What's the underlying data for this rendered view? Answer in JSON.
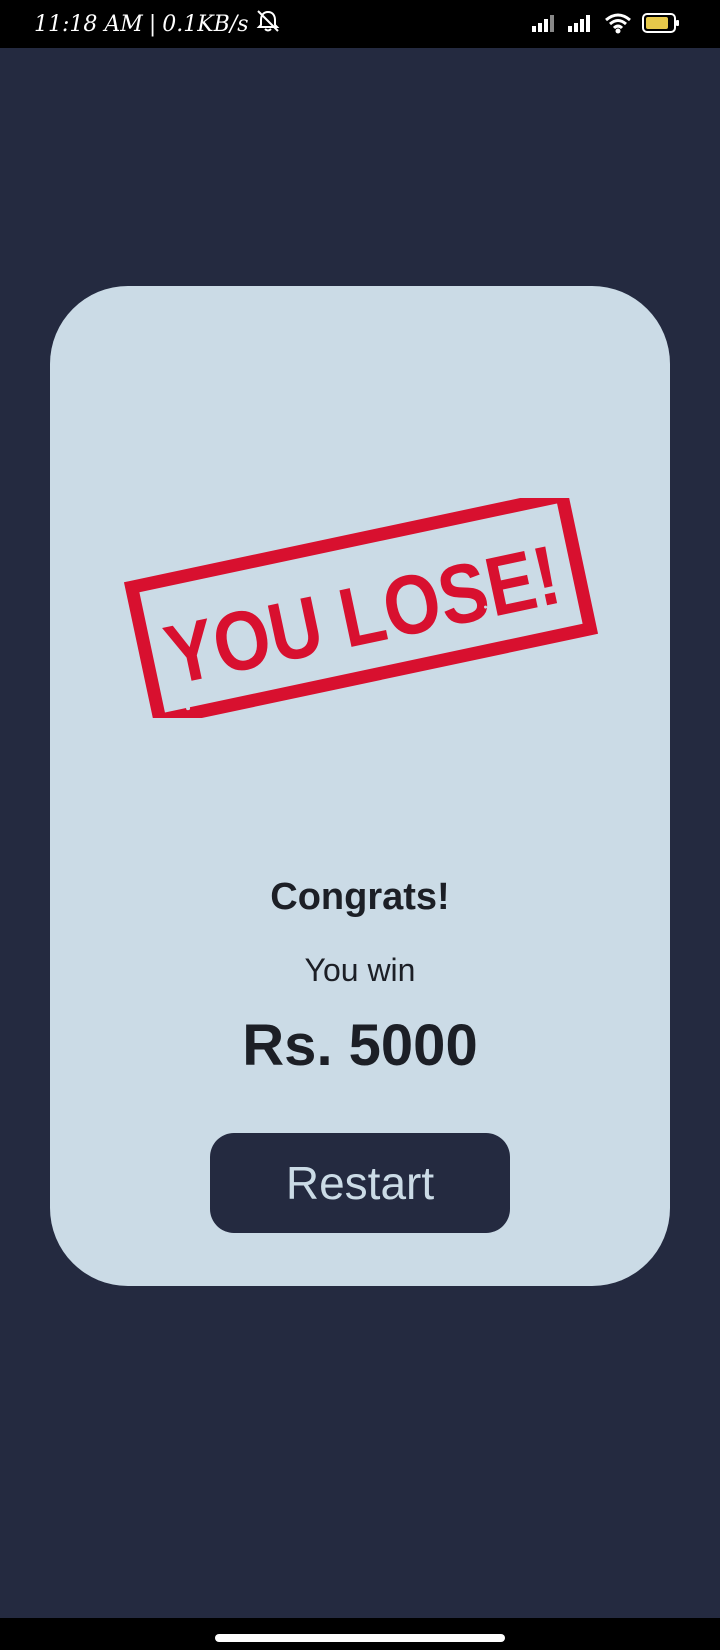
{
  "status_bar": {
    "time": "11:18 AM",
    "separator": "|",
    "network_speed": "0.1KB/s",
    "icons": [
      "alarm-off-icon",
      "signal-icon",
      "signal-icon",
      "wifi-icon",
      "battery-icon"
    ]
  },
  "result": {
    "stamp_text": "YOU LOSE!",
    "heading": "Congrats!",
    "win_label": "You win",
    "amount": "Rs. 5000",
    "restart_label": "Restart"
  },
  "colors": {
    "background": "#242a40",
    "card": "#cbdbe6",
    "stamp_red": "#d8102f",
    "text_dark": "#1c1f26",
    "button_text": "#cbdbe6"
  }
}
